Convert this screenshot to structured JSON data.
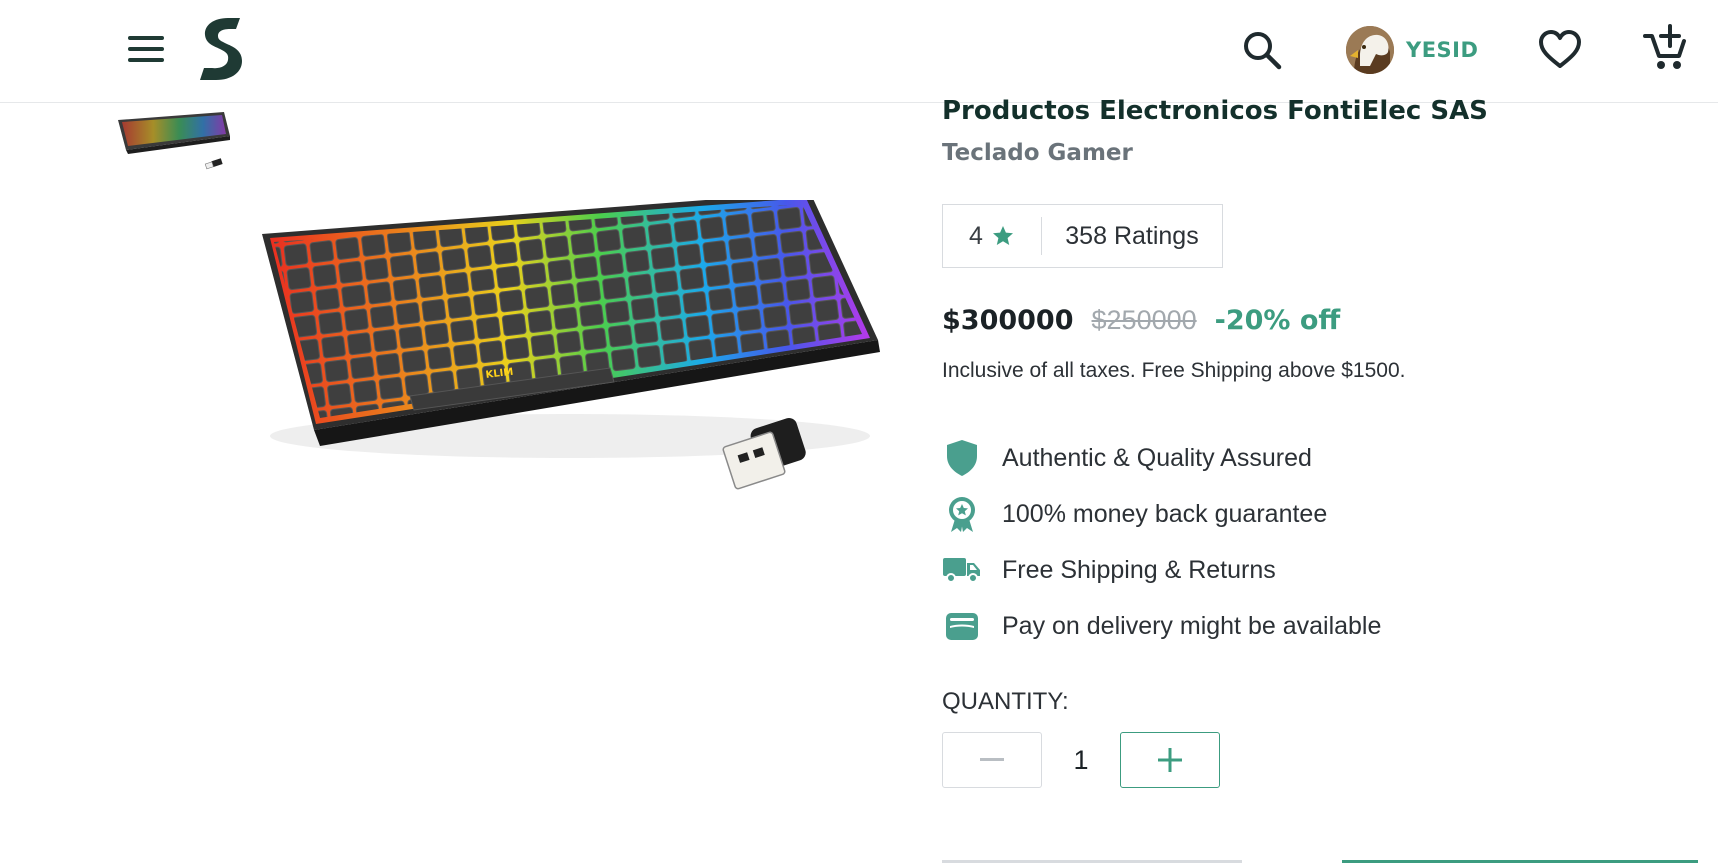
{
  "header": {
    "menu_icon": "menu-icon",
    "logo_icon": "brand-logo",
    "search_icon": "search-icon",
    "user": {
      "name": "YESID",
      "avatar": "eagle-avatar"
    },
    "wishlist_icon": "heart-icon",
    "cart_icon": "add-to-cart-icon"
  },
  "gallery": {
    "thumbnail": "keyboard-thumbnail",
    "main_image": "rgb-keyboard-with-usb-receiver"
  },
  "product": {
    "brand": "Productos Electronicos FontiElec SAS",
    "name": "Teclado Gamer",
    "rating": {
      "value": "4",
      "icon": "star-icon",
      "count_label": "358 Ratings"
    },
    "price": "$300000",
    "original_price": "$250000",
    "discount": "-20% off",
    "tax_note": "Inclusive of all taxes. Free Shipping above $1500.",
    "features": [
      {
        "icon": "shield-icon",
        "label": "Authentic & Quality Assured"
      },
      {
        "icon": "badge-icon",
        "label": "100% money back guarantee"
      },
      {
        "icon": "truck-icon",
        "label": "Free Shipping & Returns"
      },
      {
        "icon": "wallet-icon",
        "label": "Pay on delivery might be available"
      }
    ],
    "quantity": {
      "label": "QUANTITY:",
      "value": "1",
      "minus_icon": "minus-icon",
      "plus_icon": "plus-icon"
    }
  },
  "colors": {
    "accent": "#3c9c80",
    "dark_green": "#13302b",
    "text": "#2c3136",
    "muted": "#6a737a",
    "border": "#d8dbdf"
  }
}
